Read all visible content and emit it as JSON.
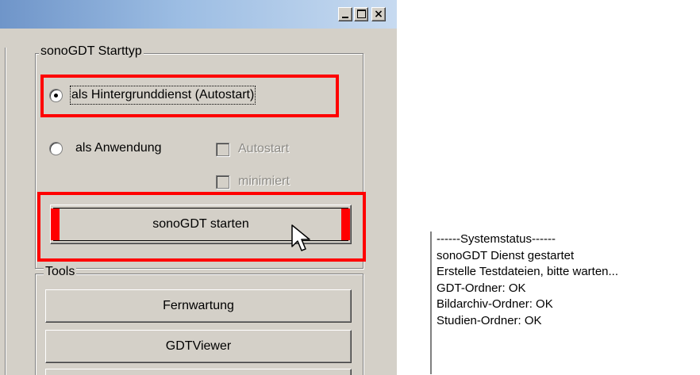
{
  "window": {
    "controls": {
      "minimize_icon": "minimize-icon",
      "maximize_icon": "maximize-icon",
      "close_glyph": "×"
    }
  },
  "start_group": {
    "title": "sonoGDT Starttyp",
    "radio_background": "als Hintergrunddienst (Autostart)",
    "radio_application": "als Anwendung",
    "checkbox_autostart": "Autostart",
    "checkbox_minimized": "minimiert",
    "start_button": "sonoGDT starten"
  },
  "tools_group": {
    "title": "Tools",
    "buttons": [
      "Fernwartung",
      "GDTViewer"
    ]
  },
  "status_panel": {
    "lines": [
      "------Systemstatus------",
      "sonoGDT Dienst gestartet",
      "Erstelle Testdateien, bitte warten...",
      "GDT-Ordner: OK",
      "Bildarchiv-Ordner: OK",
      "Studien-Ordner: OK"
    ]
  },
  "highlight_color": "#ff0000"
}
